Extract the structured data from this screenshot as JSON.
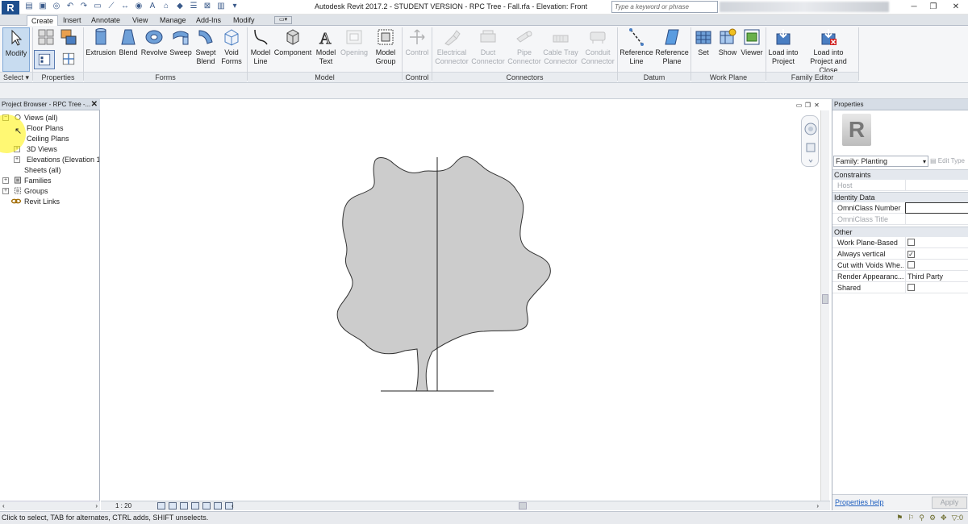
{
  "window": {
    "logo": "R",
    "title": "Autodesk Revit 2017.2 - STUDENT VERSION -    RPC Tree - Fall.rfa - Elevation: Front",
    "search_placeholder": "Type a keyword or phrase"
  },
  "tabs": [
    "Create",
    "Insert",
    "Annotate",
    "View",
    "Manage",
    "Add-Ins",
    "Modify"
  ],
  "ribbon": {
    "select_label": "Select",
    "panels": {
      "properties": "Properties",
      "forms": "Forms",
      "model": "Model",
      "control": "Control",
      "connectors": "Connectors",
      "datum": "Datum",
      "work_plane": "Work Plane",
      "family_editor": "Family Editor"
    },
    "buttons": {
      "modify": "Modify",
      "extrusion": "Extrusion",
      "blend": "Blend",
      "revolve": "Revolve",
      "sweep": "Sweep",
      "swept_blend": [
        "Swept",
        "Blend"
      ],
      "void_forms": [
        "Void",
        "Forms"
      ],
      "model_line": [
        "Model",
        "Line"
      ],
      "component": "Component",
      "model_text": [
        "Model",
        "Text"
      ],
      "opening": "Opening",
      "model_group": [
        "Model",
        "Group"
      ],
      "control": "Control",
      "electrical_connector": [
        "Electrical",
        "Connector"
      ],
      "duct_connector": [
        "Duct",
        "Connector"
      ],
      "pipe_connector": [
        "Pipe",
        "Connector"
      ],
      "cable_tray_connector": [
        "Cable Tray",
        "Connector"
      ],
      "conduit_connector": [
        "Conduit",
        "Connector"
      ],
      "reference_line": [
        "Reference",
        "Line"
      ],
      "reference_plane": [
        "Reference",
        "Plane"
      ],
      "set": "Set",
      "show": "Show",
      "viewer": "Viewer",
      "load_into_project": [
        "Load into",
        "Project"
      ],
      "load_into_project_close": [
        "Load into",
        "Project and Close"
      ]
    }
  },
  "browser": {
    "title": "Project Browser - RPC Tree -...",
    "close": "✕",
    "items": {
      "views": "Views (all)",
      "floor_plans": "Floor Plans",
      "ceiling_plans": "Ceiling Plans",
      "views_3d": "3D Views",
      "elevations": "Elevations (Elevation 1",
      "sheets": "Sheets (all)",
      "families": "Families",
      "groups": "Groups",
      "revit_links": "Revit Links"
    }
  },
  "view": {
    "scale": "1 : 20"
  },
  "properties": {
    "title": "Properties",
    "family_icon": "R",
    "type_selector": "Family: Planting",
    "edit_type": "Edit Type",
    "groups": {
      "constraints": "Constraints",
      "identity": "Identity Data",
      "other": "Other"
    },
    "rows": {
      "host": "Host",
      "omniclass_number": "OmniClass Number",
      "omniclass_title": "OmniClass Title",
      "work_plane_based": "Work Plane-Based",
      "always_vertical": "Always vertical",
      "cut_with_voids": "Cut with Voids Whe...",
      "render_appearance": "Render Appearanc...",
      "render_appearance_value": "Third Party",
      "shared": "Shared"
    },
    "checks": {
      "work_plane_based": false,
      "always_vertical": true,
      "cut_with_voids": false,
      "shared": false
    },
    "help_link": "Properties help",
    "apply": "Apply"
  },
  "status": {
    "text": "Click to select, TAB for alternates, CTRL adds, SHIFT unselects.",
    "filter_count": ":0"
  },
  "colors": {
    "tree_fill": "#cccccc",
    "accent": "#1e4f8e",
    "highlight": "#fff200"
  }
}
